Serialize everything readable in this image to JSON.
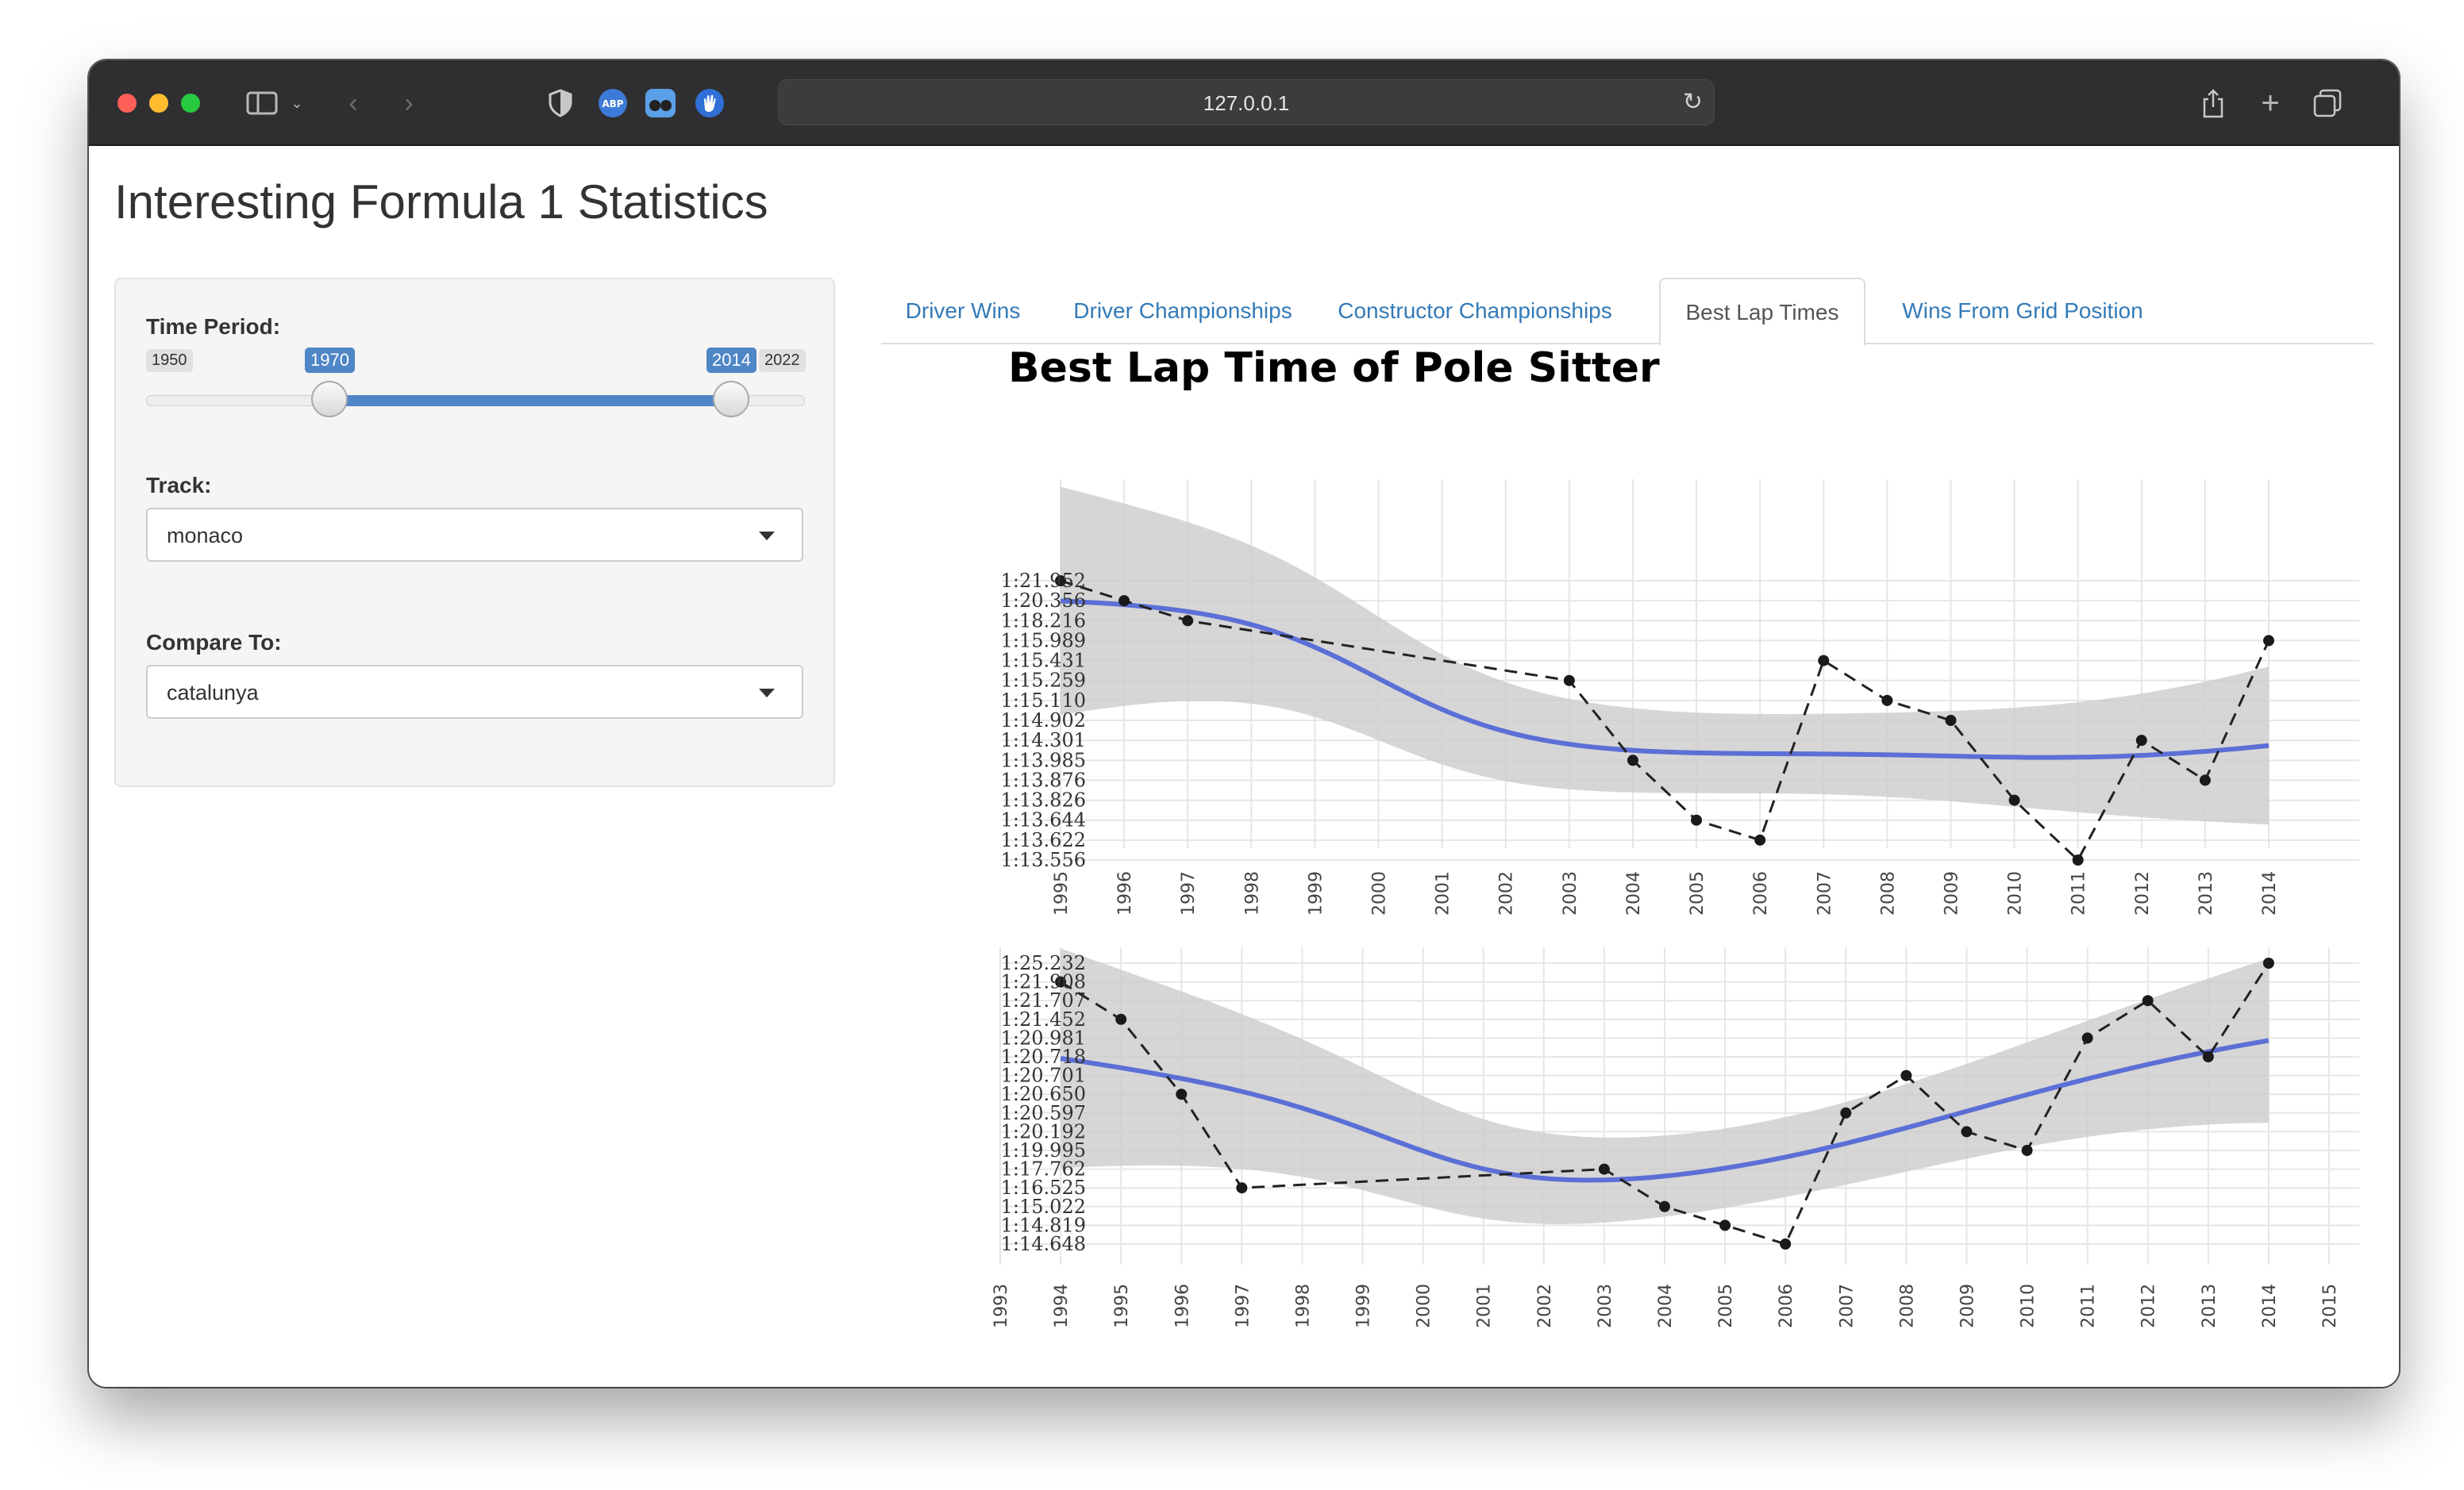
{
  "browser": {
    "url": "127.0.0.1"
  },
  "page": {
    "title": "Interesting Formula 1 Statistics"
  },
  "sidebar": {
    "time_period_label": "Time Period:",
    "slider": {
      "min_label": "1950",
      "max_label": "2022",
      "low_label": "1970",
      "high_label": "2014",
      "min": 1950,
      "max": 2022,
      "low": 1970,
      "high": 2014
    },
    "track_label": "Track:",
    "track_value": "monaco",
    "compare_label": "Compare To:",
    "compare_value": "catalunya"
  },
  "tabs": [
    {
      "label": "Driver Wins",
      "active": false
    },
    {
      "label": "Driver Championships",
      "active": false
    },
    {
      "label": "Constructor Championships",
      "active": false
    },
    {
      "label": "Best Lap Times",
      "active": true
    },
    {
      "label": "Wins From Grid Position",
      "active": false
    }
  ],
  "chart_title": "Best Lap Time of Pole Sitter",
  "colors": {
    "accent": "#4f86c6",
    "smooth_line": "#5b6fd6",
    "ribbon": "#cccccc",
    "points": "#1a1a1a"
  },
  "chart_data": [
    {
      "type": "line",
      "title": "Best Lap Time of Pole Sitter",
      "x": [
        "1995",
        "1996",
        "1997",
        "2003",
        "2004",
        "2005",
        "2006",
        "2007",
        "2008",
        "2009",
        "2010",
        "2011",
        "2012",
        "2013",
        "2014"
      ],
      "x_ticks": [
        "1995",
        "1996",
        "1997",
        "1998",
        "1999",
        "2000",
        "2001",
        "2002",
        "2003",
        "2004",
        "2005",
        "2006",
        "2007",
        "2008",
        "2009",
        "2010",
        "2011",
        "2012",
        "2013",
        "2014"
      ],
      "y_ticks": [
        "1:21.952",
        "1:20.356",
        "1:18.216",
        "1:15.989",
        "1:15.431",
        "1:15.259",
        "1:15.110",
        "1:14.902",
        "1:14.301",
        "1:13.985",
        "1:13.876",
        "1:13.826",
        "1:13.644",
        "1:13.622",
        "1:13.556"
      ],
      "y_axis": "categorical, ordered top-to-bottom as listed",
      "points": [
        {
          "x": "1995",
          "y": "1:21.952"
        },
        {
          "x": "1996",
          "y": "1:20.356"
        },
        {
          "x": "1997",
          "y": "1:18.216"
        },
        {
          "x": "2003",
          "y": "1:15.259"
        },
        {
          "x": "2004",
          "y": "1:13.985"
        },
        {
          "x": "2005",
          "y": "1:13.644"
        },
        {
          "x": "2006",
          "y": "1:13.622"
        },
        {
          "x": "2007",
          "y": "1:15.431"
        },
        {
          "x": "2008",
          "y": "1:15.110"
        },
        {
          "x": "2009",
          "y": "1:14.902"
        },
        {
          "x": "2010",
          "y": "1:13.826"
        },
        {
          "x": "2011",
          "y": "1:13.556"
        },
        {
          "x": "2012",
          "y": "1:14.301"
        },
        {
          "x": "2013",
          "y": "1:13.876"
        },
        {
          "x": "2014",
          "y": "1:15.989"
        }
      ],
      "grid": true
    },
    {
      "type": "line",
      "x_ticks": [
        "1993",
        "1994",
        "1995",
        "1996",
        "1997",
        "1998",
        "1999",
        "2000",
        "2001",
        "2002",
        "2003",
        "2004",
        "2005",
        "2006",
        "2007",
        "2008",
        "2009",
        "2010",
        "2011",
        "2012",
        "2013",
        "2014",
        "2015"
      ],
      "y_ticks": [
        "1:25.232",
        "1:21.908",
        "1:21.707",
        "1:21.452",
        "1:20.981",
        "1:20.718",
        "1:20.701",
        "1:20.650",
        "1:20.597",
        "1:20.192",
        "1:19.995",
        "1:17.762",
        "1:16.525",
        "1:15.022",
        "1:14.819",
        "1:14.648"
      ],
      "y_axis": "categorical, ordered top-to-bottom as listed",
      "points": [
        {
          "x": "1994",
          "y": "1:21.908"
        },
        {
          "x": "1995",
          "y": "1:21.452"
        },
        {
          "x": "1996",
          "y": "1:20.650"
        },
        {
          "x": "1997",
          "y": "1:16.525"
        },
        {
          "x": "2003",
          "y": "1:17.762"
        },
        {
          "x": "2004",
          "y": "1:15.022"
        },
        {
          "x": "2005",
          "y": "1:14.819"
        },
        {
          "x": "2006",
          "y": "1:14.648"
        },
        {
          "x": "2007",
          "y": "1:20.597"
        },
        {
          "x": "2008",
          "y": "1:20.701"
        },
        {
          "x": "2009",
          "y": "1:20.192"
        },
        {
          "x": "2010",
          "y": "1:19.995"
        },
        {
          "x": "2011",
          "y": "1:20.981"
        },
        {
          "x": "2012",
          "y": "1:21.707"
        },
        {
          "x": "2013",
          "y": "1:20.718"
        },
        {
          "x": "2014",
          "y": "1:25.232"
        }
      ],
      "grid": true
    }
  ]
}
